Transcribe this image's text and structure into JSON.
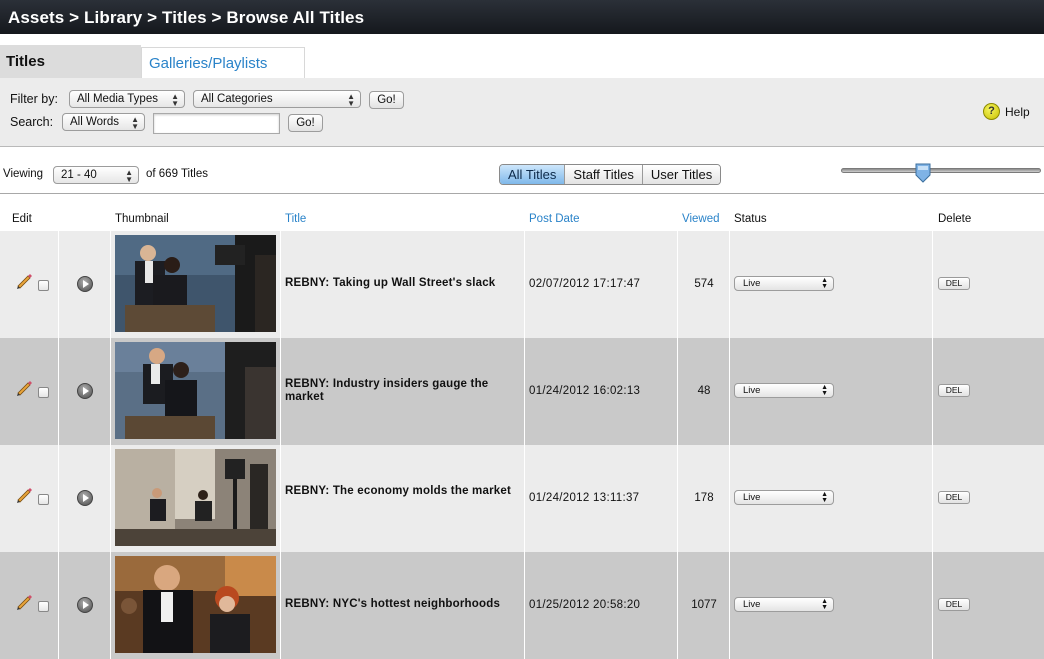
{
  "breadcrumb": "Assets > Library > Titles > Browse All Titles",
  "tabs": {
    "titles": "Titles",
    "galleries": "Galleries/Playlists"
  },
  "filter": {
    "filter_label": "Filter by:",
    "media_type": "All Media Types",
    "category": "All Categories",
    "go": "Go!",
    "search_label": "Search:",
    "search_mode": "All Words",
    "search_value": ""
  },
  "help": {
    "icon": "?",
    "label": "Help"
  },
  "viewing": {
    "label": "Viewing",
    "range": "21 - 40",
    "total": "of 669 Titles"
  },
  "segments": {
    "all": "All Titles",
    "staff": "Staff Titles",
    "user": "User Titles"
  },
  "slider_value": 0.41,
  "columns": {
    "edit": "Edit",
    "thumbnail": "Thumbnail",
    "title": "Title",
    "post_date": "Post Date",
    "viewed": "Viewed",
    "status": "Status",
    "delete": "Delete"
  },
  "rows": [
    {
      "title": "REBNY: Taking up Wall Street's slack",
      "post_date": "02/07/2012 17:17:47",
      "viewed": "574",
      "status": "Live",
      "del": "DEL"
    },
    {
      "title": "REBNY: Industry insiders gauge the market",
      "post_date": "01/24/2012 16:02:13",
      "viewed": "48",
      "status": "Live",
      "del": "DEL"
    },
    {
      "title": "REBNY: The economy molds the market",
      "post_date": "01/24/2012 13:11:37",
      "viewed": "178",
      "status": "Live",
      "del": "DEL"
    },
    {
      "title": "REBNY: NYC's hottest neighborhoods",
      "post_date": "01/25/2012 20:58:20",
      "viewed": "1077",
      "status": "Live",
      "del": "DEL"
    }
  ],
  "colors": {
    "link": "#2a83c9",
    "topbar": "#1c2026",
    "row_light": "#ececec",
    "row_dark": "#c9c9c9",
    "segment_active": "#7fb8ea"
  }
}
